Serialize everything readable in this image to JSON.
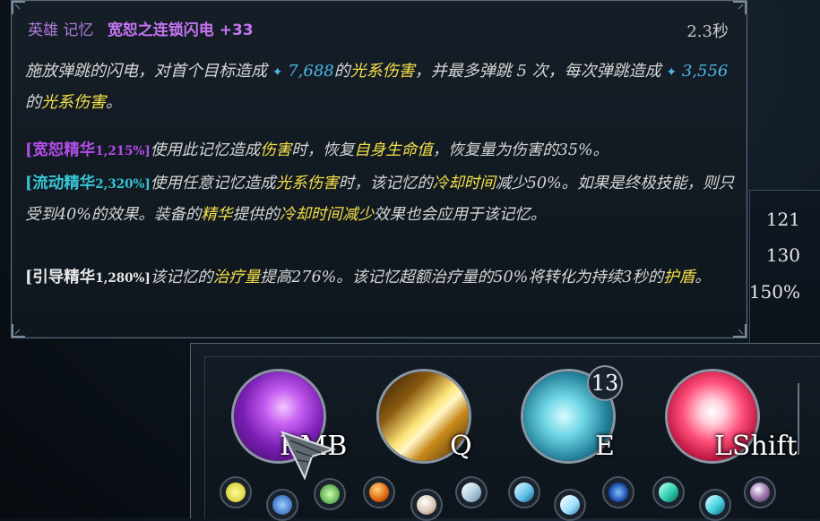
{
  "stats": {
    "values": [
      "121",
      "130",
      "150%"
    ]
  },
  "tooltip": {
    "category": "英雄 记忆",
    "name": "宽恕之连锁闪电 +33",
    "cooldown": "2.3秒",
    "desc": {
      "p1": "施放弹跳的闪电，对首个目标造成",
      "dmg1": "7,688",
      "p2": "的",
      "type1": "光系伤害",
      "p3": "，并最多弹跳 5 次，每次弹跳造成",
      "dmg2": "3,556",
      "p4": "的",
      "type2": "光系伤害",
      "p5": "。"
    },
    "essences": [
      {
        "tag": "[宽恕精华",
        "pct": "1,215%]",
        "t1": "使用此记忆造成",
        "k1": "伤害",
        "t2": "时，恢复",
        "k2": "自身生命值",
        "t3": "，恢复量为伤害的35%。"
      },
      {
        "tag": "[流动精华",
        "pct": "2,320%]",
        "t1": "使用任意记忆造成",
        "k1": "光系伤害",
        "t2": "时，该记忆的",
        "k2": "冷却时间",
        "t3": "减少50%。如果是终极技能，则只受到40%的效果。装备的",
        "k3": "精华",
        "t4": "提供的",
        "k4": "冷却时间减少",
        "t5": "效果也会应用于该记忆。"
      },
      {
        "tag": "[引导精华",
        "pct": "1,280%]",
        "t1": "该记忆的",
        "k1": "治疗量",
        "t2": "提高276%。该记忆超额治疗量的50%将转化为持续3秒的",
        "k2": "护盾",
        "t3": "。"
      }
    ]
  },
  "skills": [
    {
      "key": "RMB",
      "icon": "lightning-orb-icon"
    },
    {
      "key": "Q",
      "icon": "light-beam-icon"
    },
    {
      "key": "E",
      "icon": "ice-hand-icon",
      "charges": "13"
    },
    {
      "key": "LShift",
      "icon": "radiant-body-icon"
    }
  ],
  "gems": [
    "yellow-gem-icon",
    "blue-crystal-icon",
    "green-leaf-icon",
    "orange-orb-icon",
    "white-pearl-icon",
    "diamond-gem-icon",
    "ice-crystal-icon",
    "light-diamond-icon",
    "blue-flame-icon",
    "cyan-cube-icon",
    "teal-crystal-icon",
    "dark-pearl-icon"
  ]
}
